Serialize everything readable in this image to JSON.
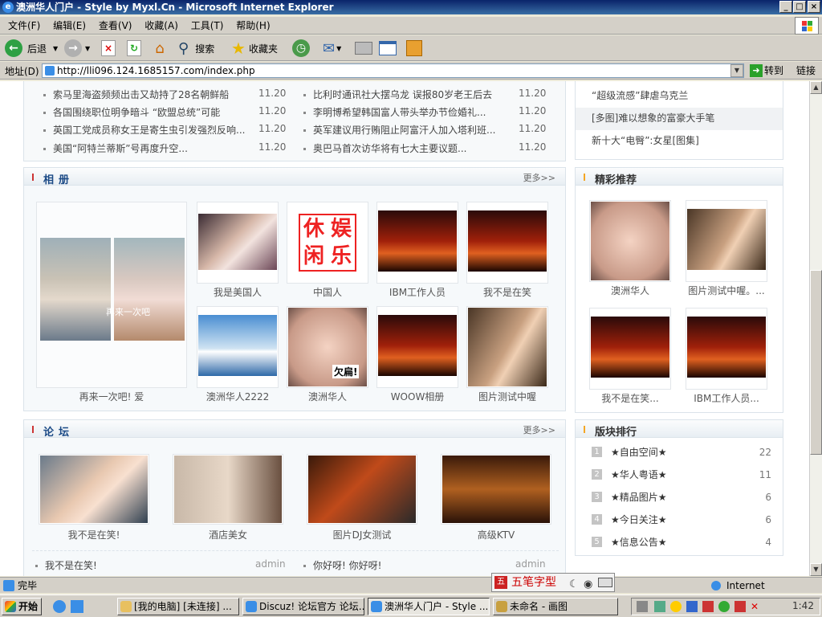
{
  "window": {
    "title": "澳洲华人门户 - Style by Myxl.Cn - Microsoft Internet Explorer"
  },
  "menu": [
    "文件(F)",
    "编辑(E)",
    "查看(V)",
    "收藏(A)",
    "工具(T)",
    "帮助(H)"
  ],
  "toolbar": {
    "back": "后退",
    "search": "搜索",
    "favorites": "收藏夹"
  },
  "address": {
    "label": "地址(D)",
    "url": "http://lli096.124.1685157.com/index.php",
    "go": "转到",
    "links": "链接"
  },
  "news": {
    "left": [
      {
        "title": "索马里海盗频频出击又劫持了28名朝鲜船",
        "date": "11.20"
      },
      {
        "title": "各国围绕职位明争暗斗 “欧盟总统”可能",
        "date": "11.20"
      },
      {
        "title": "英国工党成员称女王是寄生虫引发强烈反响...",
        "date": "11.20"
      },
      {
        "title": "美国“阿特兰蒂斯”号再度升空...",
        "date": "11.20"
      }
    ],
    "right": [
      {
        "title": "比利时通讯社大摆乌龙 误报80岁老王后去",
        "date": "11.20"
      },
      {
        "title": "李明博希望韩国富人带头举办节俭婚礼...",
        "date": "11.20"
      },
      {
        "title": "英军建议用行贿阻止阿富汗人加入塔利班...",
        "date": "11.20"
      },
      {
        "title": "奥巴马首次访华将有七大主要议题...",
        "date": "11.20"
      }
    ]
  },
  "side_news": [
    "“超级流感”肆虐乌克兰",
    "[多图]难以想象的富豪大手笔",
    "新十大“电臀”:女星[图集]"
  ],
  "album": {
    "title": "相册",
    "more": "更多>>",
    "featured": {
      "caption": "再来一次吧! 爱",
      "overlay": "再来一次吧"
    },
    "items": [
      {
        "caption": "我是美国人"
      },
      {
        "caption": "中国人",
        "art": [
          "休",
          "娱",
          "闲",
          "乐"
        ]
      },
      {
        "caption": "IBM工作人员"
      },
      {
        "caption": "我不是在笑"
      },
      {
        "caption": "澳洲华人2222"
      },
      {
        "caption": "澳洲华人",
        "stamp": "欠扁!"
      },
      {
        "caption": "WOOW相册"
      },
      {
        "caption": "图片测试中喔"
      }
    ]
  },
  "recommend": {
    "title": "精彩推荐",
    "items": [
      {
        "caption": "澳洲华人"
      },
      {
        "caption": "图片测试中喔。..."
      },
      {
        "caption": "我不是在笑..."
      },
      {
        "caption": "IBM工作人员..."
      }
    ]
  },
  "forum": {
    "title": "论坛",
    "more": "更多>>",
    "items": [
      {
        "caption": "我不是在笑!"
      },
      {
        "caption": "酒店美女"
      },
      {
        "caption": "图片DJ女测试"
      },
      {
        "caption": "高级KTV"
      }
    ],
    "threads": [
      {
        "title": "我不是在笑!",
        "author": "admin"
      },
      {
        "title": "你好呀! 你好呀!",
        "author": "admin"
      }
    ]
  },
  "ranking": {
    "title": "版块排行",
    "items": [
      {
        "rank": "1",
        "name": "★自由空间★",
        "count": "22"
      },
      {
        "rank": "2",
        "name": "★华人粤语★",
        "count": "11"
      },
      {
        "rank": "3",
        "name": "★精品图片★",
        "count": "6"
      },
      {
        "rank": "4",
        "name": "★今日关注★",
        "count": "6"
      },
      {
        "rank": "5",
        "name": "★信息公告★",
        "count": "4"
      }
    ]
  },
  "status": {
    "text": "完毕",
    "zone": "Internet"
  },
  "ime": {
    "label": "五笔字型"
  },
  "taskbar": {
    "start": "开始",
    "tasks": [
      "[我的电脑] [未连接] ...",
      "Discuz! 论坛官方 论坛...",
      "澳洲华人门户 - Style ...",
      "未命名 - 画图"
    ],
    "clock": "1:42"
  }
}
